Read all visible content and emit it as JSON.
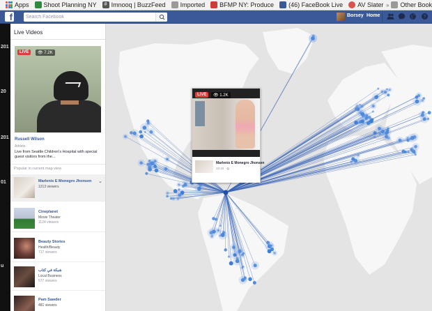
{
  "bookmarks": [
    {
      "label": "Apps",
      "icon": "apps-grid-icon",
      "color": "#e25b3b"
    },
    {
      "label": "Shoot Planning NY",
      "icon": "bookmark-icon",
      "color": "#2d8a3e"
    },
    {
      "label": "Imnooq | BuzzFeed...",
      "icon": "hash-icon",
      "color": "#555555"
    },
    {
      "label": "Imported",
      "icon": "folder-icon",
      "color": "#8a8a8a"
    },
    {
      "label": "BFMP NY: Producer/...",
      "icon": "page-icon",
      "color": "#d03a3a"
    },
    {
      "label": "(46) FaceBook Live...",
      "icon": "facebook-icon",
      "color": "#3b5998"
    },
    {
      "label": "AV Slater",
      "icon": "av-icon",
      "color": "#d9534f"
    },
    {
      "label": "Other Book",
      "icon": "folder-icon",
      "color": "#8a8a8a"
    }
  ],
  "fbbar": {
    "logo": "f",
    "search_placeholder": "Search Facebook",
    "user": "Borsey",
    "home": "Home"
  },
  "panel": {
    "title": "Live Videos",
    "featured": {
      "live": "LIVE",
      "views": "7.2K",
      "name": "Russell Wilson",
      "role": "Athlete",
      "desc": "Live from Seattle Children's Hospital with special guest visitors from the..."
    },
    "popular_label": "Popular in current map view",
    "items": [
      {
        "title": "Marlenis E Monegro Jhonsen",
        "sub": "1213 viewers",
        "sub2": ""
      },
      {
        "title": "Cineplanet",
        "sub": "Movie Theater",
        "sub2": "1124 viewers"
      },
      {
        "title": "Beauty Stories",
        "sub": "Health/Beauty",
        "sub2": "717 viewers"
      },
      {
        "title": "شبكة في كتاب",
        "sub": "Local Business",
        "sub2": "577 viewers"
      },
      {
        "title": "Pam Sawder",
        "sub": "481 viewers",
        "sub2": ""
      }
    ]
  },
  "popup": {
    "live": "LIVE",
    "views": "1.2K",
    "title": "Marlenis E Monegro Jhonsen",
    "sub": "10:10 · ◍"
  },
  "strip": [
    "201",
    "20",
    "201",
    "01",
    "u"
  ],
  "colors": {
    "fb_blue": "#3b5998",
    "map_bg": "#e4e4e4",
    "land": "#f7f7f7",
    "dot": "#3b7dd8",
    "live_red": "#e03b3b"
  }
}
